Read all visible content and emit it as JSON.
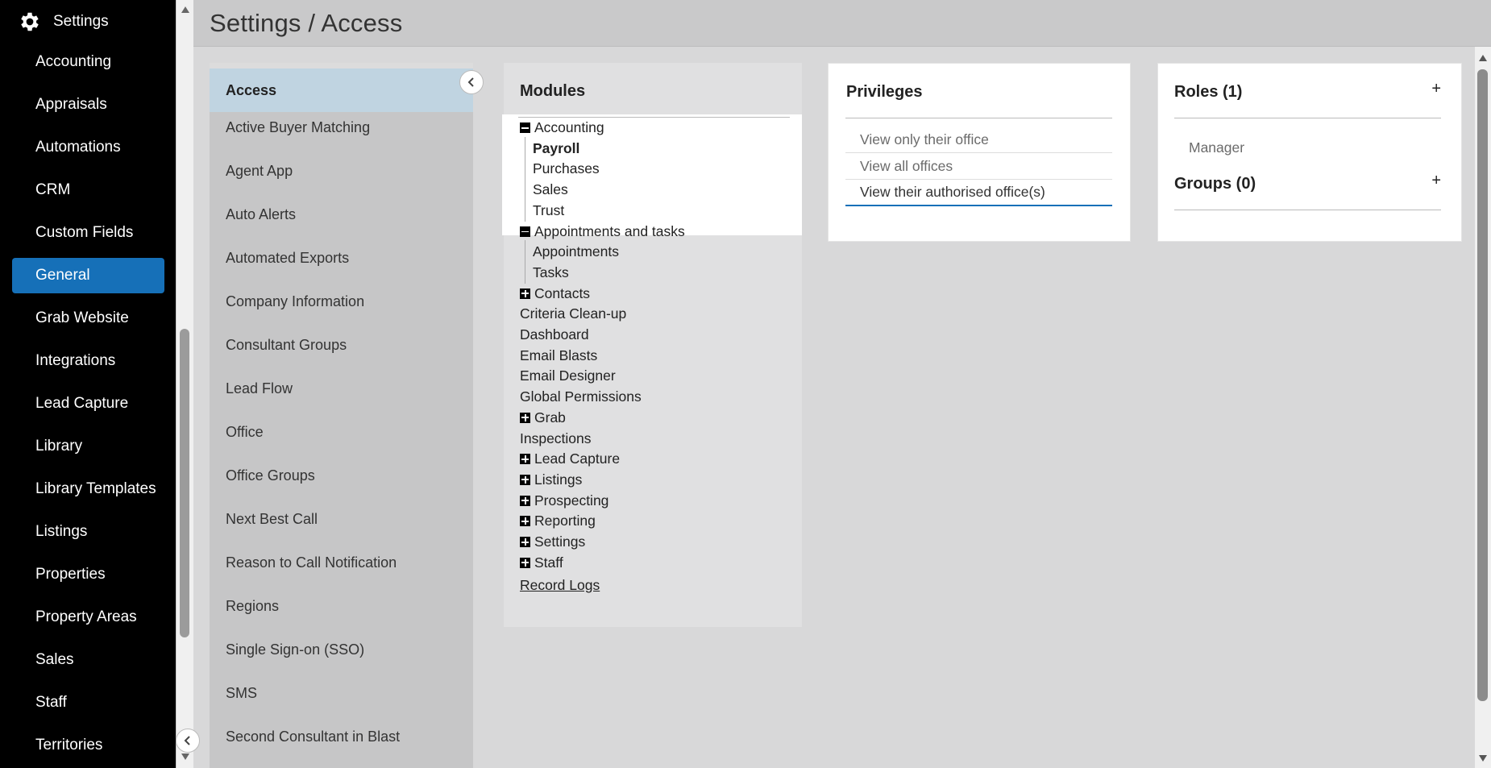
{
  "nav": {
    "title": "Settings",
    "items": [
      {
        "label": "Accounting",
        "active": false
      },
      {
        "label": "Appraisals",
        "active": false
      },
      {
        "label": "Automations",
        "active": false
      },
      {
        "label": "CRM",
        "active": false
      },
      {
        "label": "Custom Fields",
        "active": false
      },
      {
        "label": "General",
        "active": true
      },
      {
        "label": "Grab Website",
        "active": false
      },
      {
        "label": "Integrations",
        "active": false
      },
      {
        "label": "Lead Capture",
        "active": false
      },
      {
        "label": "Library",
        "active": false
      },
      {
        "label": "Library Templates",
        "active": false
      },
      {
        "label": "Listings",
        "active": false
      },
      {
        "label": "Properties",
        "active": false
      },
      {
        "label": "Property Areas",
        "active": false
      },
      {
        "label": "Sales",
        "active": false
      },
      {
        "label": "Staff",
        "active": false
      },
      {
        "label": "Territories",
        "active": false
      }
    ]
  },
  "header": {
    "title": "Settings / Access"
  },
  "settings_list": [
    "Access",
    "Active Buyer Matching",
    "Agent App",
    "Auto Alerts",
    "Automated Exports",
    "Company Information",
    "Consultant Groups",
    "Lead Flow",
    "Office",
    "Office Groups",
    "Next Best Call",
    "Reason to Call Notification",
    "Regions",
    "Single Sign-on (SSO)",
    "SMS",
    "Second Consultant in Blast"
  ],
  "modules": {
    "title": "Modules",
    "tree": [
      {
        "label": "Accounting",
        "icon": "minus",
        "level": 0
      },
      {
        "label": "Payroll",
        "icon": "",
        "level": 1,
        "bold": true
      },
      {
        "label": "Purchases",
        "icon": "",
        "level": 1
      },
      {
        "label": "Sales",
        "icon": "",
        "level": 1
      },
      {
        "label": "Trust",
        "icon": "",
        "level": 1
      },
      {
        "label": "Appointments and tasks",
        "icon": "minus",
        "level": 0
      },
      {
        "label": "Appointments",
        "icon": "",
        "level": 1
      },
      {
        "label": "Tasks",
        "icon": "",
        "level": 1
      },
      {
        "label": "Contacts",
        "icon": "plus",
        "level": 0
      },
      {
        "label": "Criteria Clean-up",
        "icon": "",
        "level": 0
      },
      {
        "label": "Dashboard",
        "icon": "",
        "level": 0
      },
      {
        "label": "Email Blasts",
        "icon": "",
        "level": 0
      },
      {
        "label": "Email Designer",
        "icon": "",
        "level": 0
      },
      {
        "label": "Global Permissions",
        "icon": "",
        "level": 0
      },
      {
        "label": "Grab",
        "icon": "plus",
        "level": 0
      },
      {
        "label": "Inspections",
        "icon": "",
        "level": 0
      },
      {
        "label": "Lead Capture",
        "icon": "plus",
        "level": 0
      },
      {
        "label": "Listings",
        "icon": "plus",
        "level": 0
      },
      {
        "label": "Prospecting",
        "icon": "plus",
        "level": 0
      },
      {
        "label": "Reporting",
        "icon": "plus",
        "level": 0
      },
      {
        "label": "Settings",
        "icon": "plus",
        "level": 0
      },
      {
        "label": "Staff",
        "icon": "plus",
        "level": 0
      },
      {
        "label": "Record Logs",
        "icon": "",
        "level": 0,
        "link": true
      }
    ]
  },
  "privileges": {
    "title": "Privileges",
    "options": [
      {
        "label": "View only their office",
        "selected": false
      },
      {
        "label": "View all offices",
        "selected": false
      },
      {
        "label": "View their authorised office(s)",
        "selected": true
      }
    ]
  },
  "roles": {
    "title": "Roles (1)",
    "items": [
      "Manager"
    ],
    "add": "+"
  },
  "groups": {
    "title": "Groups (0)",
    "add": "+"
  },
  "colors": {
    "accent": "#1670b8",
    "nav_bg": "#000000",
    "selected_row": "#c0d4e1"
  },
  "icons": {
    "brand": "gear-icon",
    "collapse": "chevron-left-icon"
  }
}
